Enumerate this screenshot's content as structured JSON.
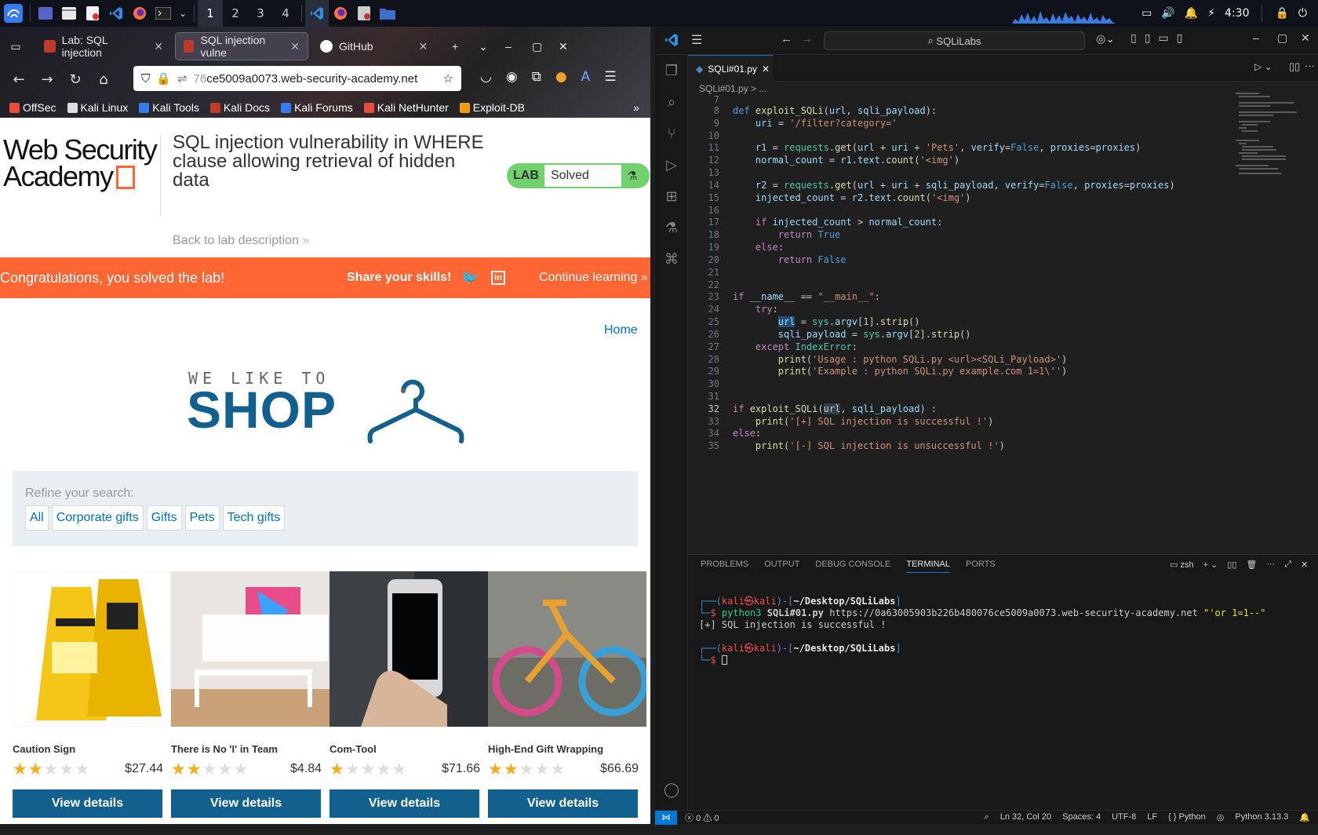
{
  "taskbar": {
    "workspaces": [
      "1",
      "2",
      "3",
      "4"
    ],
    "active_workspace": "1",
    "clock": "4:30"
  },
  "firefox": {
    "tabs": [
      {
        "label": "Lab: SQL injection",
        "active": false
      },
      {
        "label": "SQL injection vulne",
        "active": true
      },
      {
        "label": "GitHub",
        "active": false
      }
    ],
    "url_dim": "76",
    "url_main": "ce5009a0073.web-security-academy.net",
    "bookmarks": [
      "OffSec",
      "Kali Linux",
      "Kali Tools",
      "Kali Docs",
      "Kali Forums",
      "Kali NetHunter",
      "Exploit-DB"
    ]
  },
  "page": {
    "logo_line1": "Web Security",
    "logo_line2": "Academy",
    "lab_title": "SQL injection vulnerability in WHERE clause allowing retrieval of hidden data",
    "back_link": "Back to lab description",
    "lab_badge": "LAB",
    "lab_status": "Solved",
    "banner_msg": "Congratulations, you solved the lab!",
    "share": "Share your skills!",
    "continue": "Continue learning",
    "home": "Home",
    "shop_tag": "WE LIKE TO",
    "shop_word": "SHOP",
    "refine_label": "Refine your search:",
    "filters": [
      "All",
      "Corporate gifts",
      "Gifts",
      "Pets",
      "Tech gifts"
    ],
    "view_details": "View details",
    "products": [
      {
        "name": "Caution Sign",
        "rating": 2,
        "price": "$27.44"
      },
      {
        "name": "There is No 'I' in Team",
        "rating": 2,
        "price": "$4.84"
      },
      {
        "name": "Com-Tool",
        "rating": 1,
        "price": "$71.66"
      },
      {
        "name": "High-End Gift Wrapping",
        "rating": 2,
        "price": "$66.69"
      }
    ]
  },
  "vscode": {
    "search": "SQLiLabs",
    "tab": "SQLi#01.py",
    "breadcrumb": "SQLi#01.py > ...",
    "panel_tabs": [
      "PROBLEMS",
      "OUTPUT",
      "DEBUG CONSOLE",
      "TERMINAL",
      "PORTS"
    ],
    "active_panel_tab": "TERMINAL",
    "shell": "zsh",
    "terminal": {
      "prompt_user": "kali㉿kali",
      "prompt_path": "~/Desktop/SQLiLabs",
      "cmd_prefix": "python3",
      "cmd_file": "SQLi#01.py",
      "cmd_url": "https://0a63005903b226b480076ce5009a0073.web-security-academy.net",
      "cmd_payload": "\"'or 1=1--\"",
      "output": "[+] SQL injection is successful !"
    },
    "status": {
      "errors": "0",
      "warnings": "0",
      "position": "Ln 32, Col 20",
      "spaces": "Spaces: 4",
      "encoding": "UTF-8",
      "eol": "LF",
      "language": "Python",
      "interpreter": "Python 3.13.3"
    }
  }
}
